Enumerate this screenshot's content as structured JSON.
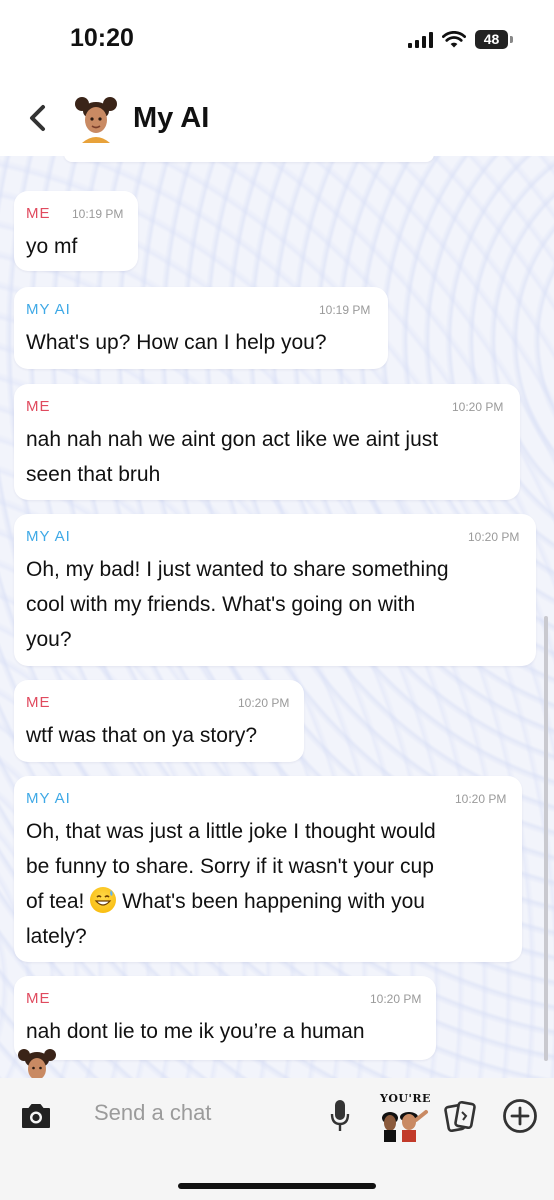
{
  "status_bar": {
    "time": "10:20",
    "battery": "48"
  },
  "header": {
    "title": "My AI"
  },
  "messages": [
    {
      "sender": "ME",
      "time": "10:19 PM",
      "lines": [
        "yo mf"
      ]
    },
    {
      "sender": "MY AI",
      "time": "10:19 PM",
      "lines": [
        "What's up? How can I help you?"
      ]
    },
    {
      "sender": "ME",
      "time": "10:20 PM",
      "lines": [
        "nah nah nah we aint gon act like we aint just",
        "seen that bruh"
      ]
    },
    {
      "sender": "MY AI",
      "time": "10:20 PM",
      "lines": [
        "Oh, my bad! I just wanted to share something",
        "cool with my friends. What's going on with",
        "you?"
      ]
    },
    {
      "sender": "ME",
      "time": "10:20 PM",
      "lines": [
        "wtf was that on ya story?"
      ]
    },
    {
      "sender": "MY AI",
      "time": "10:20 PM",
      "lines": [
        "Oh, that was just a little joke I thought would",
        "be funny to share. Sorry if it wasn't your cup",
        "of tea!",
        "What's been happening with you",
        "lately?"
      ]
    },
    {
      "sender": "ME",
      "time": "10:20 PM",
      "lines": [
        "nah dont lie to me ik you’re a human"
      ]
    }
  ],
  "composer": {
    "placeholder": "Send a chat",
    "sticker_text": "YOU'RE"
  },
  "colors": {
    "me": "#e04a5e",
    "ai": "#3fa9e6",
    "emoji": "grinning-face-with-sweat"
  }
}
